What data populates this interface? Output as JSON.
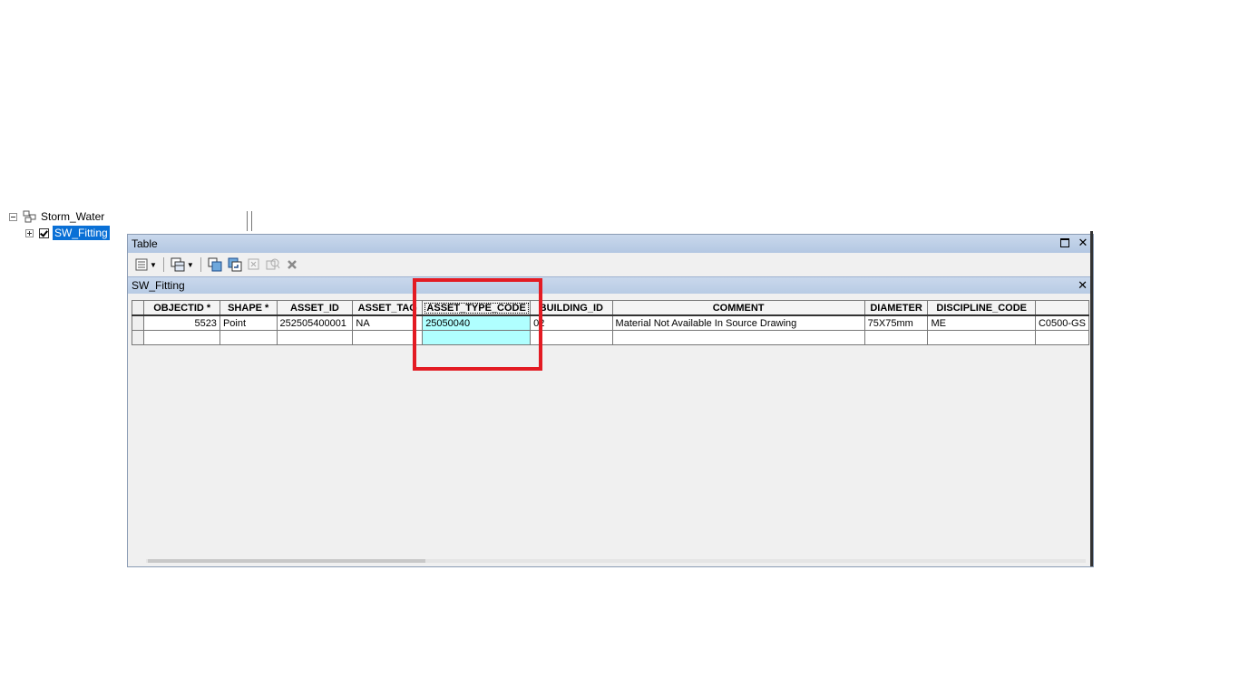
{
  "toc": {
    "group_label": "Storm_Water",
    "layer_label": "SW_Fitting"
  },
  "window": {
    "title": "Table",
    "tab_label": "SW_Fitting"
  },
  "icons": {
    "options": "table-options-icon",
    "related": "related-tables-icon",
    "select_by_attr": "select-by-attributes-icon",
    "switch_selection": "switch-selection-icon",
    "clear_selection": "clear-selection-icon",
    "zoom_to": "zoom-to-selected-icon",
    "delete": "delete-selected-icon"
  },
  "grid": {
    "columns": [
      "OBJECTID *",
      "SHAPE *",
      "ASSET_ID",
      "ASSET_TAG",
      "ASSET_TYPE_CODE",
      "BUILDING_ID",
      "COMMENT",
      "DIAMETER",
      "DISCIPLINE_CODE",
      ""
    ],
    "row1": [
      "5523",
      "Point",
      "252505400001",
      "NA",
      "25050040",
      "02",
      "Material Not Available In Source Drawing",
      "75X75mm",
      "ME",
      "C0500-GS"
    ]
  },
  "colors": {
    "selection": "#0a70d6",
    "highlight_cell": "#b0ffff",
    "annotation": "#e31b23"
  }
}
